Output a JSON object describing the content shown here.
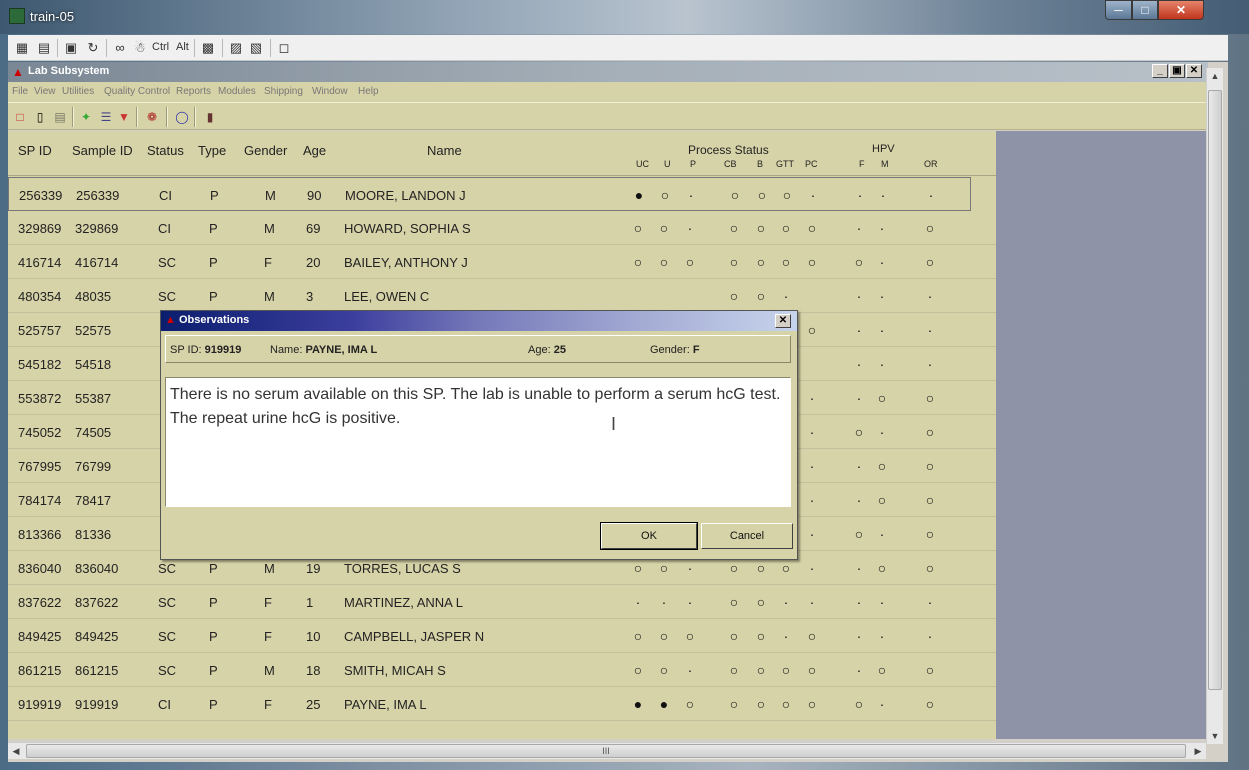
{
  "outer_window": {
    "title": "train-05",
    "toolbar_text_ctrl": "Ctrl",
    "toolbar_text_alt": "Alt"
  },
  "app": {
    "title": "Lab Subsystem",
    "menu": [
      "File",
      "View",
      "Utilities",
      "Quality Control",
      "Reports",
      "Modules",
      "Shipping",
      "Window",
      "Help"
    ]
  },
  "grid": {
    "headers": {
      "sp_id": "SP ID",
      "sample_id": "Sample ID",
      "status": "Status",
      "type": "Type",
      "gender": "Gender",
      "age": "Age",
      "name": "Name",
      "process_status": "Process Status",
      "hpv": "HPV"
    },
    "subheaders": [
      "UC",
      "U",
      "P",
      "CB",
      "B",
      "GTT",
      "PC",
      "F",
      "M",
      "OR"
    ],
    "rows": [
      {
        "sp_id": "256339",
        "sample_id": "256339",
        "status": "CI",
        "type": "P",
        "gender": "M",
        "age": "90",
        "name": "MOORE, LANDON J",
        "marks": [
          "●",
          "○",
          "·",
          "○",
          "○",
          "○",
          "·",
          "·",
          "·",
          "·"
        ]
      },
      {
        "sp_id": "329869",
        "sample_id": "329869",
        "status": "CI",
        "type": "P",
        "gender": "M",
        "age": "69",
        "name": "HOWARD, SOPHIA S",
        "marks": [
          "○",
          "○",
          "·",
          "○",
          "○",
          "○",
          "○",
          "·",
          "·",
          "○"
        ]
      },
      {
        "sp_id": "416714",
        "sample_id": "416714",
        "status": "SC",
        "type": "P",
        "gender": "F",
        "age": "20",
        "name": "BAILEY, ANTHONY J",
        "marks": [
          "○",
          "○",
          "○",
          "○",
          "○",
          "○",
          "○",
          "○",
          "·",
          "○"
        ]
      },
      {
        "sp_id": "480354",
        "sample_id": "48035",
        "status": "SC",
        "type": "P",
        "gender": "M",
        "age": "3",
        "name": "LEE, OWEN C",
        "marks": [
          "",
          "",
          "",
          "○",
          "○",
          "·",
          "",
          "·",
          "·",
          "·"
        ]
      },
      {
        "sp_id": "525757",
        "sample_id": "52575",
        "status": "",
        "type": "",
        "gender": "",
        "age": "",
        "name": "",
        "marks": [
          "",
          "",
          "",
          "",
          "",
          "○",
          "○",
          "·",
          "·",
          "·"
        ]
      },
      {
        "sp_id": "545182",
        "sample_id": "54518",
        "status": "",
        "type": "",
        "gender": "",
        "age": "",
        "name": "",
        "marks": [
          "",
          "",
          "",
          "",
          "",
          "·",
          "",
          "·",
          "·",
          "·"
        ]
      },
      {
        "sp_id": "553872",
        "sample_id": "55387",
        "status": "",
        "type": "",
        "gender": "",
        "age": "",
        "name": "",
        "marks": [
          "",
          "",
          "",
          "",
          "",
          "○",
          "·",
          "·",
          "○",
          "○"
        ]
      },
      {
        "sp_id": "745052",
        "sample_id": "74505",
        "status": "",
        "type": "",
        "gender": "",
        "age": "",
        "name": "",
        "marks": [
          "",
          "",
          "",
          "",
          "",
          "○",
          "·",
          "○",
          "·",
          "○"
        ]
      },
      {
        "sp_id": "767995",
        "sample_id": "76799",
        "status": "",
        "type": "",
        "gender": "",
        "age": "",
        "name": "",
        "marks": [
          "",
          "",
          "",
          "",
          "",
          "○",
          "·",
          "·",
          "○",
          "○"
        ]
      },
      {
        "sp_id": "784174",
        "sample_id": "78417",
        "status": "",
        "type": "",
        "gender": "",
        "age": "",
        "name": "",
        "marks": [
          "",
          "",
          "",
          "",
          "",
          "○",
          "·",
          "·",
          "○",
          "○"
        ]
      },
      {
        "sp_id": "813366",
        "sample_id": "81336",
        "status": "",
        "type": "",
        "gender": "",
        "age": "",
        "name": "",
        "marks": [
          "",
          "",
          "",
          "",
          "",
          "○",
          "·",
          "○",
          "·",
          "○"
        ]
      },
      {
        "sp_id": "836040",
        "sample_id": "836040",
        "status": "SC",
        "type": "P",
        "gender": "M",
        "age": "19",
        "name": "TORRES, LUCAS S",
        "marks": [
          "○",
          "○",
          "·",
          "○",
          "○",
          "○",
          "·",
          "·",
          "○",
          "○"
        ]
      },
      {
        "sp_id": "837622",
        "sample_id": "837622",
        "status": "SC",
        "type": "P",
        "gender": "F",
        "age": "1",
        "name": "MARTINEZ, ANNA L",
        "marks": [
          "·",
          "·",
          "·",
          "○",
          "○",
          "·",
          "·",
          "·",
          "·",
          "·"
        ]
      },
      {
        "sp_id": "849425",
        "sample_id": "849425",
        "status": "SC",
        "type": "P",
        "gender": "F",
        "age": "10",
        "name": "CAMPBELL, JASPER N",
        "marks": [
          "○",
          "○",
          "○",
          "○",
          "○",
          "·",
          "○",
          "·",
          "·",
          "·"
        ]
      },
      {
        "sp_id": "861215",
        "sample_id": "861215",
        "status": "SC",
        "type": "P",
        "gender": "M",
        "age": "18",
        "name": "SMITH, MICAH S",
        "marks": [
          "○",
          "○",
          "·",
          "○",
          "○",
          "○",
          "○",
          "·",
          "○",
          "○"
        ]
      },
      {
        "sp_id": "919919",
        "sample_id": "919919",
        "status": "CI",
        "type": "P",
        "gender": "F",
        "age": "25",
        "name": "PAYNE, IMA L",
        "marks": [
          "●",
          "●",
          "○",
          "○",
          "○",
          "○",
          "○",
          "○",
          "·",
          "○"
        ]
      }
    ]
  },
  "dialog": {
    "title": "Observations",
    "sp_id_label": "SP ID:",
    "sp_id_value": "919919",
    "name_label": "Name:",
    "name_value": "PAYNE, IMA L",
    "age_label": "Age:",
    "age_value": "25",
    "gender_label": "Gender:",
    "gender_value": "F",
    "text": "There is no serum available on this SP.  The lab is unable to perform a serum hcG test.  The repeat urine hcG is positive.",
    "ok_label": "OK",
    "cancel_label": "Cancel"
  },
  "scrollbar": {
    "h_grip": "III"
  }
}
